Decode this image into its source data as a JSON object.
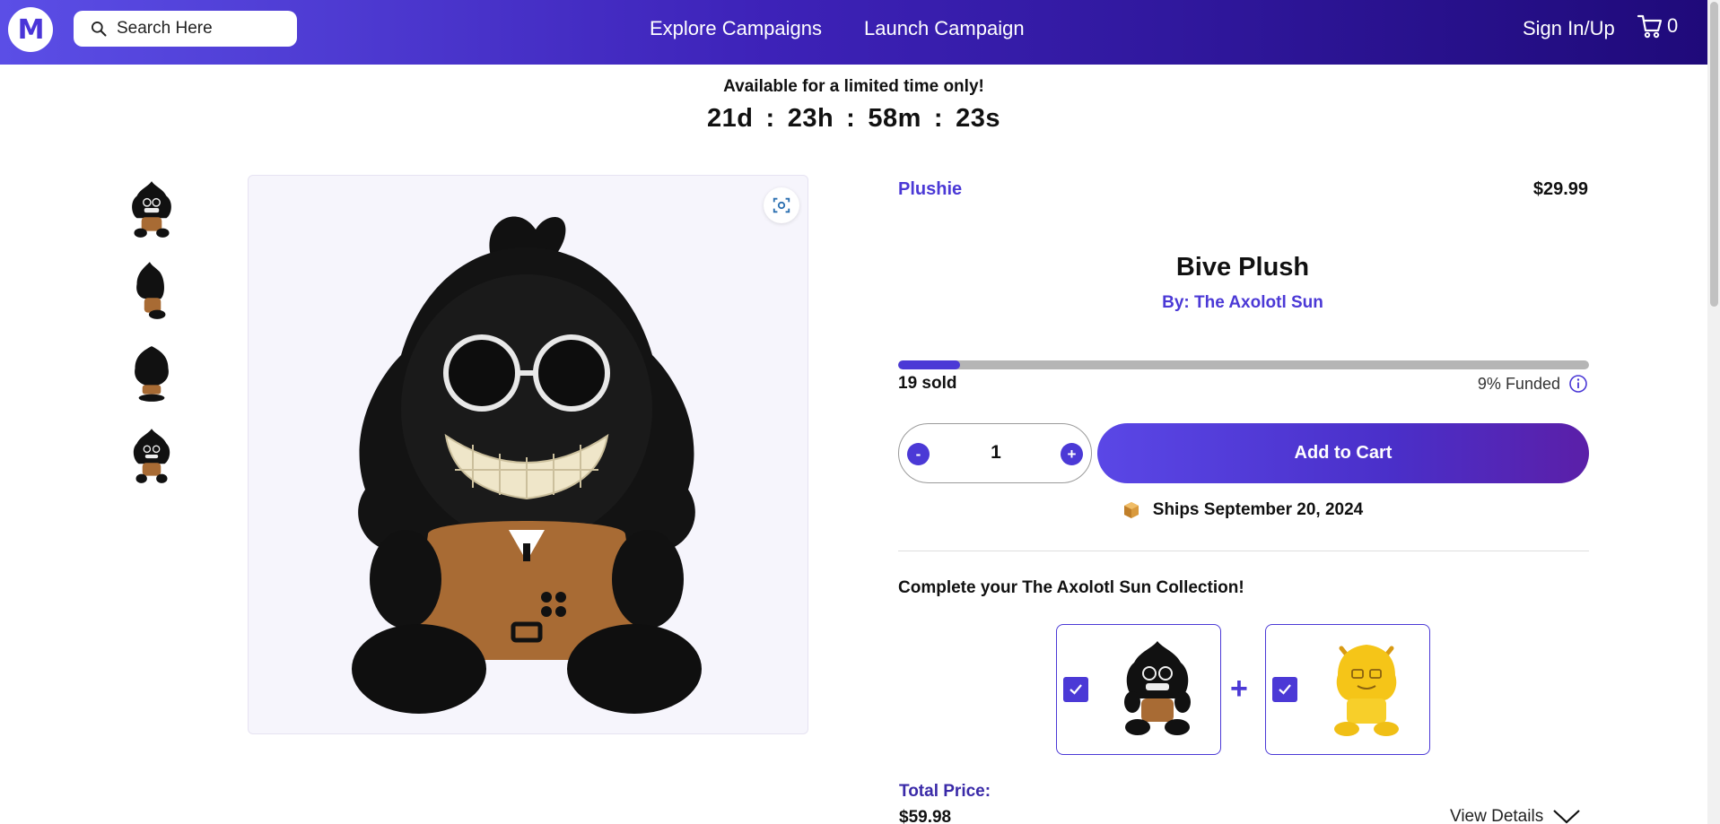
{
  "header": {
    "logo_letter": "M",
    "search_placeholder": "Search Here",
    "nav_explore": "Explore Campaigns",
    "nav_launch": "Launch Campaign",
    "sign_in": "Sign In/Up",
    "cart_count": "0"
  },
  "banner": {
    "limited_text": "Available for a limited time only!",
    "days": "21d",
    "hours": "23h",
    "minutes": "58m",
    "seconds": "23s",
    "separator": ":"
  },
  "product": {
    "category": "Plushie",
    "price": "$29.99",
    "title": "Bive Plush",
    "byline": "By: The Axolotl Sun",
    "progress_fraction": 0.09,
    "sold": "19 sold",
    "funded": "9% Funded",
    "quantity": "1",
    "qty_minus": "-",
    "qty_plus": "+",
    "add_to_cart": "Add to Cart",
    "ships": "Ships September 20, 2024"
  },
  "thumbnails": [
    "front",
    "side",
    "back",
    "front-small"
  ],
  "bundle": {
    "heading": "Complete your The Axolotl Sun Collection!",
    "plus": "+",
    "total_label": "Total Price:",
    "total_value": "$59.98",
    "view_details": "View Details"
  },
  "colors": {
    "accent": "#4b39d6",
    "header_start": "#5b4ee6",
    "header_end": "#1f0a7a"
  }
}
